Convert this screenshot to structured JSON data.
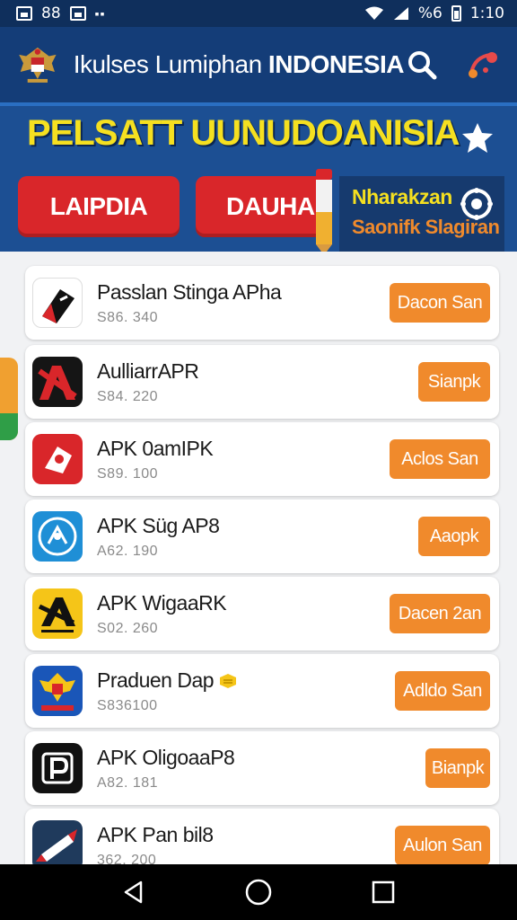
{
  "status_bar": {
    "left_text": "88",
    "signal_text": "%6",
    "time": "1:10"
  },
  "app_bar": {
    "title_regular": "Ikulses Lumiphan ",
    "title_bold": "INDONESIA",
    "icons": [
      "emblem-icon",
      "search-icon",
      "share-icon"
    ]
  },
  "banner": {
    "heading": "PELSATT UUNUDOANISIA",
    "button_left": "LAIPDIA",
    "button_right": "DAUHA",
    "promo_line1": "Nharakzan",
    "promo_line2": "Saonifk Slagiran"
  },
  "apps": [
    {
      "name": "Passlan Stinga APha",
      "meta": "S86. 340",
      "button": "Dacon San",
      "icon": "pen-app-icon"
    },
    {
      "name": "AulliarrAPR",
      "meta": "S84. 220",
      "button": "Sianpk",
      "icon": "red-a-app-icon"
    },
    {
      "name": "APK 0amIPK",
      "meta": "S89. 100",
      "button": "Aclos San",
      "icon": "tag-app-icon"
    },
    {
      "name": "APK Süg AP8",
      "meta": "A62. 190",
      "button": "Aaopk",
      "icon": "globe-app-icon"
    },
    {
      "name": "APK WigaaRK",
      "meta": "S02. 260",
      "button": "Dacen 2an",
      "icon": "yellow-a-app-icon"
    },
    {
      "name": "Praduen Dap",
      "meta": "S836100",
      "button": "Adldo San",
      "icon": "garuda-app-icon"
    },
    {
      "name": "APK OligoaaP8",
      "meta": "A82. 181",
      "button": "Bianpk",
      "icon": "p-app-icon"
    },
    {
      "name": "APK Pan bil8",
      "meta": "362. 200",
      "button": "Aulon San",
      "icon": "rocket-app-icon"
    }
  ],
  "colors": {
    "primary": "#143d78",
    "accent": "#f08a2c",
    "banner_red": "#d9262a",
    "banner_yellow": "#f5e020"
  }
}
